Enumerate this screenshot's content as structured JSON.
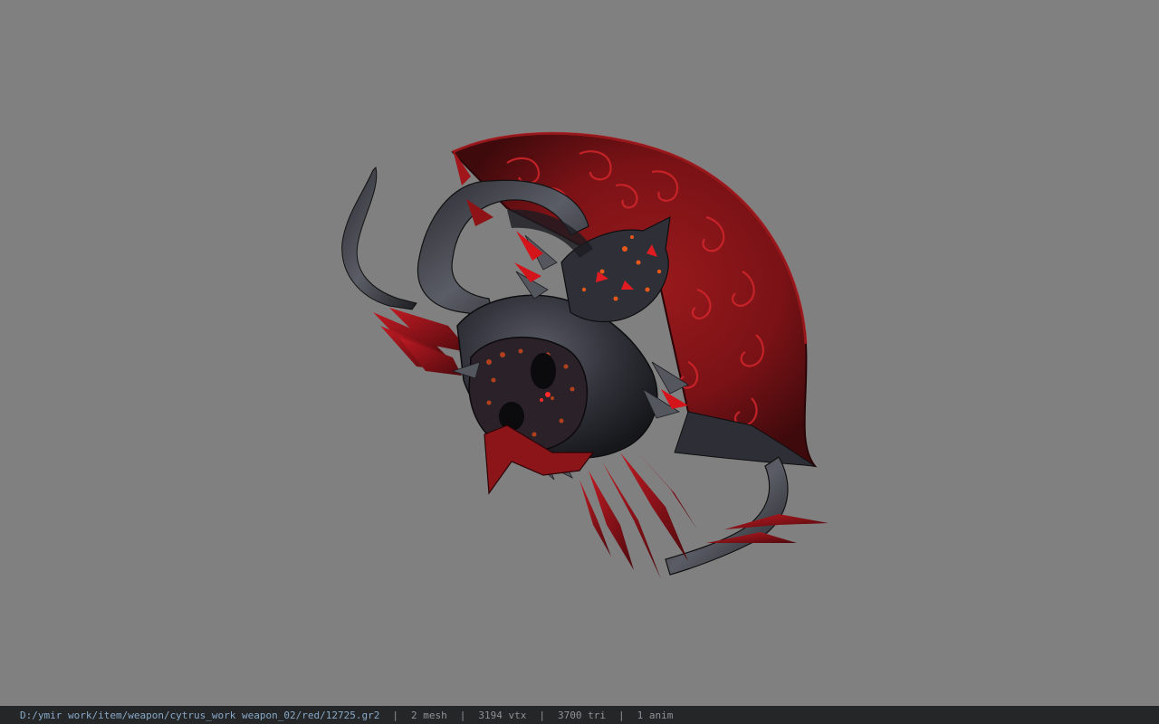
{
  "viewer": {
    "background_color": "#808080",
    "model_icon": "demon-shield-model-icon"
  },
  "status_bar": {
    "file_path": "D:/ymir work/item/weapon/cytrus_work weapon_02/red/12725.gr2",
    "separator": "|",
    "mesh_count": "2 mesh",
    "vertex_count": "3194 vtx",
    "triangle_count": "3700 tri",
    "anim_count": "1 anim"
  }
}
